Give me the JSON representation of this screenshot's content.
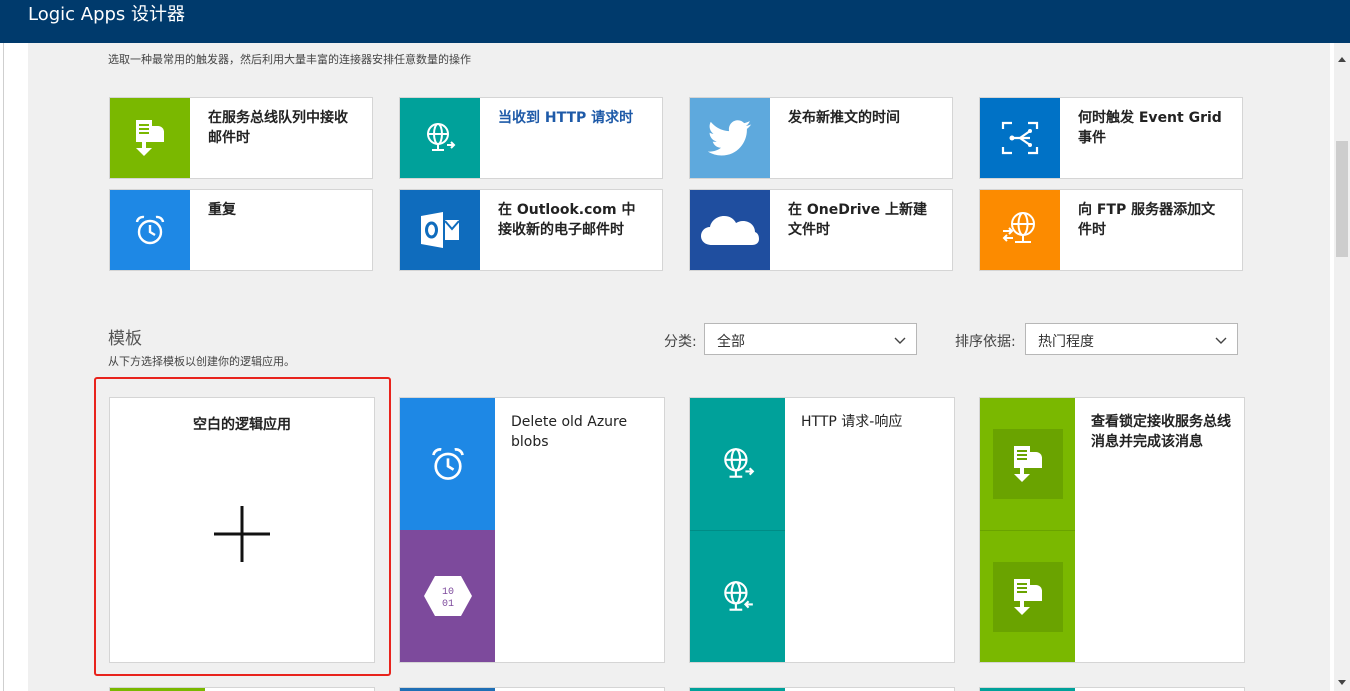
{
  "window": {
    "title": "Logic Apps 设计器"
  },
  "intro_text": "选取一种最常用的触发器，然后利用大量丰富的连接器安排任意数量的操作",
  "triggers": [
    {
      "label": "在服务总线队列中接收邮件时",
      "icon": "service-bus-icon",
      "color": "#7ab800"
    },
    {
      "label": "当收到 HTTP 请求时",
      "icon": "http-globe-icon",
      "color": "#00a19a"
    },
    {
      "label": "发布新推文的时间",
      "icon": "twitter-bird-icon",
      "color": "#5ea9dd"
    },
    {
      "label": "何时触发 Event Grid 事件",
      "icon": "event-grid-icon",
      "color": "#0072c6"
    },
    {
      "label": "重复",
      "icon": "alarm-clock-icon",
      "color": "#1e88e5"
    },
    {
      "label": "在 Outlook.com 中接收新的电子邮件时",
      "icon": "outlook-icon",
      "color": "#0f6cbd"
    },
    {
      "label": "在 OneDrive 上新建文件时",
      "icon": "onedrive-cloud-icon",
      "color": "#1f4e9f"
    },
    {
      "label": "向 FTP 服务器添加文件时",
      "icon": "ftp-globe-icon",
      "color": "#fc8b00"
    }
  ],
  "templates_section": {
    "title": "模板",
    "subtitle": "从下方选择模板以创建你的逻辑应用。",
    "category_label": "分类:",
    "category_value": "全部",
    "sort_label": "排序依据:",
    "sort_value": "热门程度"
  },
  "templates": [
    {
      "title": "空白的逻辑应用",
      "icon": "plus-icon"
    },
    {
      "title": "Delete old Azure blobs",
      "icons": [
        "alarm-clock-icon",
        "blob-storage-icon"
      ],
      "colors": [
        "#1e88e5",
        "#7d4a9c"
      ]
    },
    {
      "title": "HTTP 请求-响应",
      "icons": [
        "http-globe-icon",
        "http-globe-icon"
      ],
      "colors": [
        "#00a19a",
        "#00a19a"
      ]
    },
    {
      "title": "查看锁定接收服务总线消息并完成该消息",
      "icons": [
        "service-bus-icon",
        "service-bus-icon"
      ],
      "colors": [
        "#7ab800",
        "#7ab800"
      ]
    }
  ],
  "colors": {
    "header": "#003a6c",
    "highlight": "#e8231c"
  }
}
